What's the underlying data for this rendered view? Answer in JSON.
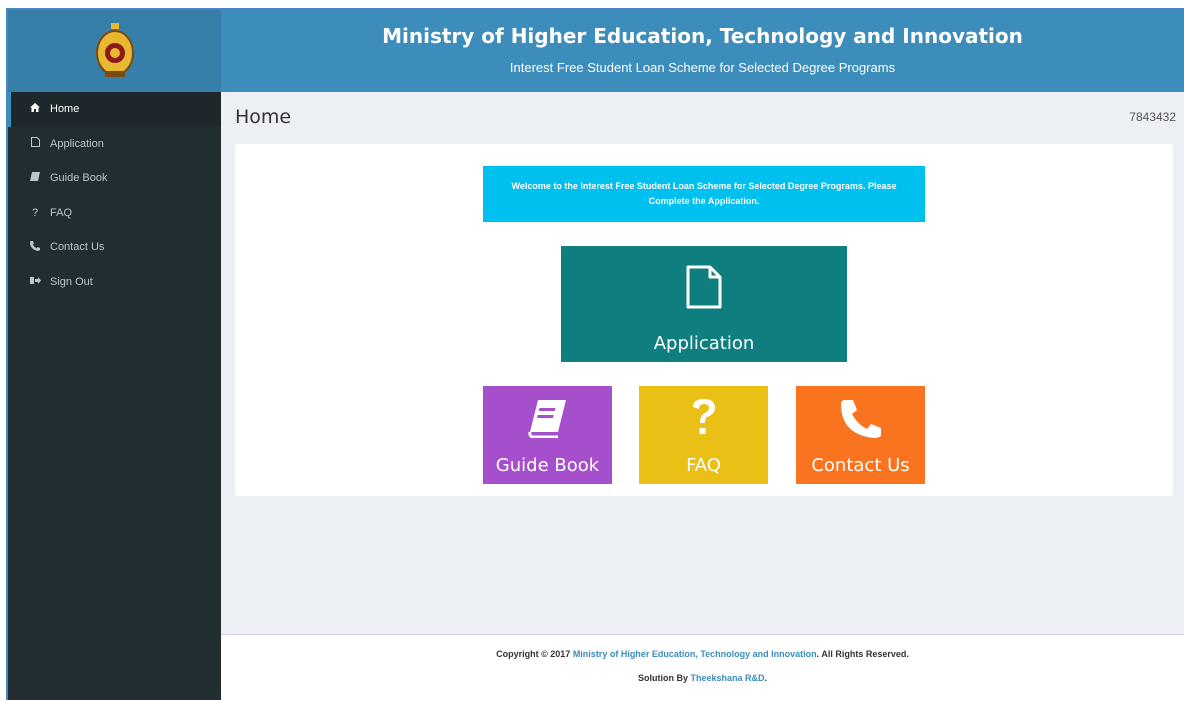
{
  "header": {
    "title": "Ministry of Higher Education, Technology and Innovation",
    "subtitle": "Interest Free Student Loan Scheme for Selected Degree Programs",
    "emblem_icon": "sri-lanka-emblem-icon"
  },
  "sidebar": {
    "items": [
      {
        "label": "Home",
        "icon": "home-icon",
        "active": true
      },
      {
        "label": "Application",
        "icon": "file-icon",
        "active": false
      },
      {
        "label": "Guide Book",
        "icon": "book-icon",
        "active": false
      },
      {
        "label": "FAQ",
        "icon": "question-icon",
        "active": false
      },
      {
        "label": "Contact Us",
        "icon": "phone-icon",
        "active": false
      },
      {
        "label": "Sign Out",
        "icon": "sign-out-icon",
        "active": false
      }
    ]
  },
  "main": {
    "page_title": "Home",
    "user_id": "7843432",
    "welcome": "Welcome to the Interest Free Student Loan Scheme for Selected Degree Programs. Please Complete the Application.",
    "tiles": {
      "application": {
        "label": "Application",
        "color": "#0e7f7e",
        "icon": "file-icon"
      },
      "guide_book": {
        "label": "Guide Book",
        "color": "#a64fcc",
        "icon": "book-icon"
      },
      "faq": {
        "label": "FAQ",
        "color": "#eac016",
        "icon": "question-icon"
      },
      "contact": {
        "label": "Contact Us",
        "color": "#fa7420",
        "icon": "phone-icon"
      }
    }
  },
  "footer": {
    "copyright_prefix": "Copyright © 2017",
    "ministry_link": "Ministry of Higher Education, Technology and Innovation",
    "rights": ". All Rights Reserved.",
    "solution_prefix": "Solution By",
    "solution_link": "Theekshana R&D",
    "solution_suffix": "."
  },
  "colors": {
    "header": "#3c8dbc",
    "sidebar": "#222d32",
    "welcome": "#00c0ef"
  }
}
